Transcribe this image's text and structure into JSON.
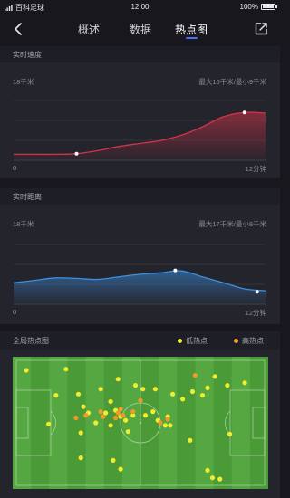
{
  "status_bar": {
    "app_name": "百科足球",
    "time": "12:00",
    "battery": "100%"
  },
  "nav": {
    "tabs": [
      {
        "label": "概述",
        "active": false
      },
      {
        "label": "数据",
        "active": false
      },
      {
        "label": "热点图",
        "active": true
      }
    ],
    "accent_color": "#4d6ef5"
  },
  "speed_chart": {
    "title": "实时速度",
    "y_label": "18千米",
    "summary": "最大16千米/最小9千米",
    "x_start": "0",
    "x_end": "12分钟",
    "line_color": "#d0344a"
  },
  "distance_chart": {
    "title": "实时距离",
    "y_label": "18千米",
    "summary": "最大17千米/最小8千米",
    "x_start": "0",
    "x_end": "12分钟",
    "line_color": "#3d8fe0"
  },
  "heatmap": {
    "title": "全局热点图",
    "legend_low": "低热点",
    "legend_high": "高热点",
    "low_color": "#f2ec2c",
    "high_color": "#f09a2a",
    "pitch_color": "#4d9d3a"
  },
  "chart_data": [
    {
      "type": "area",
      "title": "实时速度",
      "x": [
        0,
        1,
        2,
        3,
        4,
        5,
        6,
        7,
        8,
        9,
        10,
        11,
        12
      ],
      "series": [
        {
          "values": [
            9,
            9,
            9,
            9.1,
            9.6,
            10.3,
            10.8,
            11.3,
            12.2,
            13.6,
            15.3,
            16,
            15.9
          ]
        }
      ],
      "markers": [
        {
          "x": 3,
          "y": 9.1
        },
        {
          "x": 11,
          "y": 16
        }
      ],
      "xlim": [
        0,
        12
      ],
      "ylim": [
        8,
        18
      ]
    },
    {
      "type": "area",
      "title": "实时距离",
      "x": [
        0,
        1,
        2,
        3,
        4,
        5,
        6,
        7,
        8,
        9,
        10,
        11,
        12
      ],
      "series": [
        {
          "values": [
            10.3,
            10.8,
            11.3,
            11.2,
            11,
            11.5,
            12,
            12.3,
            12.7,
            11.5,
            10.3,
            9.1,
            8.7
          ]
        }
      ],
      "markers": [
        {
          "x": 7.7,
          "y": 12.8
        },
        {
          "x": 11.6,
          "y": 8.5
        }
      ],
      "xlim": [
        0,
        12
      ],
      "ylim": [
        6,
        18
      ]
    },
    {
      "type": "scatter",
      "title": "全局热点图",
      "x_range": [
        0,
        100
      ],
      "y_range": [
        0,
        100
      ],
      "series": [
        {
          "name": "低热点",
          "points": [
            [
              4,
              8
            ],
            [
              20,
              7
            ],
            [
              16,
              28
            ],
            [
              25,
              27
            ],
            [
              34,
              23
            ],
            [
              41,
              15
            ],
            [
              48,
              20
            ],
            [
              51,
              23
            ],
            [
              56,
              23
            ],
            [
              63,
              27
            ],
            [
              67,
              31
            ],
            [
              71,
              25
            ],
            [
              75,
              28
            ],
            [
              77,
              22
            ],
            [
              80,
              13
            ],
            [
              85,
              20
            ],
            [
              92,
              18
            ],
            [
              27,
              37
            ],
            [
              29,
              42
            ],
            [
              38,
              33
            ],
            [
              36,
              42
            ],
            [
              40,
              40
            ],
            [
              42,
              45
            ],
            [
              38,
              52
            ],
            [
              44,
              48
            ],
            [
              47,
              44
            ],
            [
              52,
              44
            ],
            [
              55,
              41
            ],
            [
              57,
              48
            ],
            [
              60,
              52
            ],
            [
              62,
              52
            ],
            [
              61,
              45
            ],
            [
              45,
              57
            ],
            [
              13,
              51
            ],
            [
              26,
              58
            ],
            [
              32,
              50
            ],
            [
              26,
              78
            ],
            [
              39,
              80
            ],
            [
              42,
              87
            ],
            [
              70,
              64
            ],
            [
              77,
              88
            ],
            [
              79,
              94
            ],
            [
              82,
              95
            ],
            [
              86,
              59
            ]
          ]
        },
        {
          "name": "高热点",
          "points": [
            [
              24,
              46
            ],
            [
              28,
              44
            ],
            [
              34,
              41
            ],
            [
              35,
              45
            ],
            [
              40,
              46
            ],
            [
              41,
              42
            ],
            [
              42,
              39
            ],
            [
              43,
              44
            ],
            [
              47,
              41
            ],
            [
              50,
              32
            ],
            [
              58,
              50
            ],
            [
              61,
              47
            ],
            [
              72,
              12
            ]
          ]
        }
      ]
    }
  ]
}
